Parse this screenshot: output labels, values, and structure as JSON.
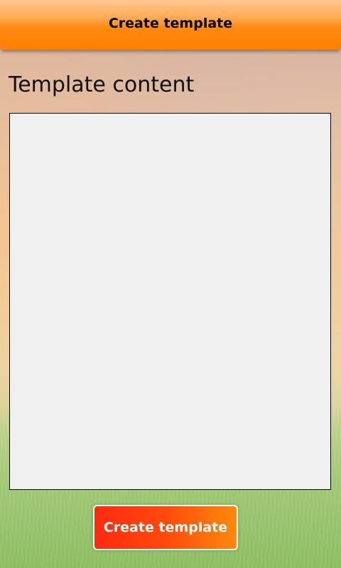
{
  "header": {
    "title": "Create template"
  },
  "main": {
    "section_title": "Template content",
    "content_value": "",
    "create_button_label": "Create template"
  },
  "colors": {
    "header_orange": "#ff7f00",
    "button_red": "#ff2a10",
    "button_orange": "#ff8a0c",
    "textbox_bg": "#f0f0f0"
  }
}
